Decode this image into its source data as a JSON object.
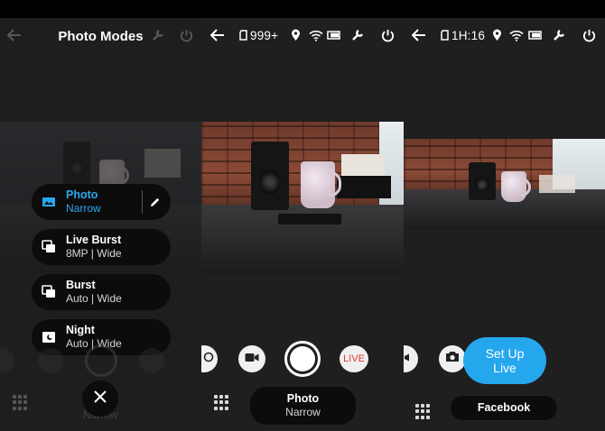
{
  "colors": {
    "accent": "#25a7ee",
    "live": "#e23a3a",
    "bg": "#1f1f1f"
  },
  "panel1": {
    "title": "Photo Modes",
    "modes": [
      {
        "name": "Photo",
        "sub": "Narrow",
        "icon": "photo-icon",
        "active": true
      },
      {
        "name": "Live Burst",
        "sub": "8MP | Wide",
        "icon": "live-burst-icon",
        "active": false
      },
      {
        "name": "Burst",
        "sub": "Auto | Wide",
        "icon": "burst-icon",
        "active": false
      },
      {
        "name": "Night",
        "sub": "Auto | Wide",
        "icon": "night-icon",
        "active": false
      }
    ],
    "faded_mode_label": "Narrow"
  },
  "panel2": {
    "status": {
      "photos_left": "999+"
    },
    "mode_pill": {
      "name": "Photo",
      "sub": "Narrow"
    },
    "live_label": "LIVE"
  },
  "panel3": {
    "status": {
      "time_left": "1H:16"
    },
    "setup_button": {
      "line1": "Set Up",
      "line2": "Live"
    },
    "destination": "Facebook"
  }
}
